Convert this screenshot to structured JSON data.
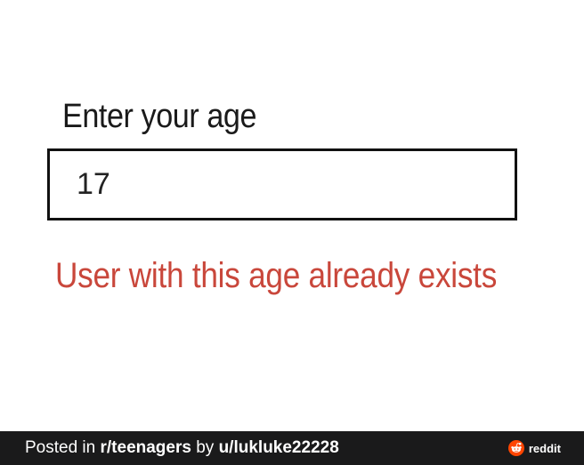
{
  "form": {
    "label": "Enter your age",
    "input_value": "17",
    "error_message": "User with this age already exists"
  },
  "footer": {
    "posted_in_prefix": "Posted in ",
    "subreddit": "r/teenagers",
    "by_text": " by ",
    "username": "u/lukluke22228",
    "brand_name": "reddit",
    "brand_icon": "reddit-logo-icon"
  },
  "colors": {
    "error_text": "#c9473b",
    "footer_background": "#1a1a1b",
    "brand_accent": "#ff4500"
  }
}
